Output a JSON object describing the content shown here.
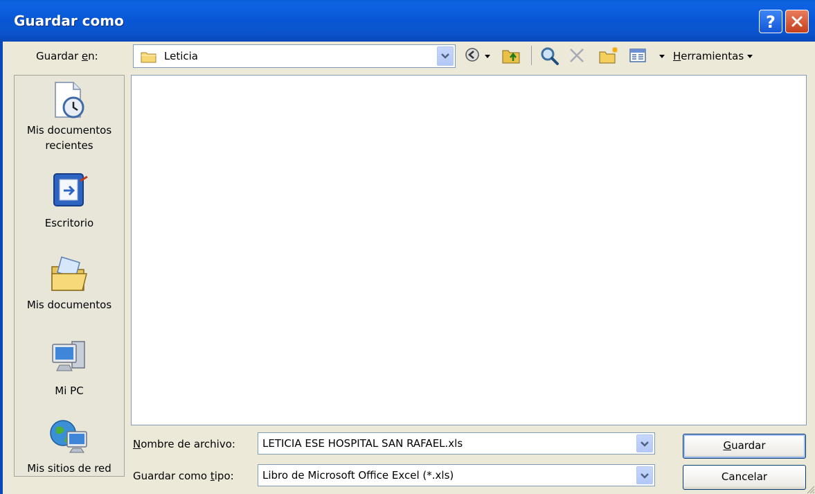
{
  "window": {
    "title": "Guardar como",
    "help_button": "?",
    "close_button": "close"
  },
  "save_in": {
    "label": "Guardar en:",
    "label_parts": [
      "Guardar ",
      "e",
      "n:"
    ],
    "value": "Leticia"
  },
  "toolbar": {
    "items": [
      "back-icon",
      "up-folder-icon",
      "search-web-icon",
      "delete-icon",
      "new-folder-icon",
      "views-icon"
    ],
    "tools_label": "Herramientas",
    "tools_parts": [
      "H",
      "erramientas"
    ]
  },
  "places": [
    {
      "label_line1": "Mis documentos",
      "label_line2": "recientes",
      "icon": "recent-documents-icon"
    },
    {
      "label_line1": "Escritorio",
      "label_line2": "",
      "icon": "desktop-icon"
    },
    {
      "label_line1": "Mis documentos",
      "label_line2": "",
      "icon": "my-documents-icon"
    },
    {
      "label_line1": "Mi PC",
      "label_line2": "",
      "icon": "my-computer-icon"
    },
    {
      "label_line1": "Mis sitios de red",
      "label_line2": "",
      "icon": "network-places-icon"
    }
  ],
  "file_name": {
    "label": "Nombre de archivo:",
    "label_parts": [
      "N",
      "ombre de archivo:"
    ],
    "value": "LETICIA ESE HOSPITAL SAN RAFAEL.xls"
  },
  "file_type": {
    "label": "Guardar como tipo:",
    "label_parts": [
      "Guardar como ",
      "t",
      "ipo:"
    ],
    "value": "Libro de Microsoft Office Excel (*.xls)"
  },
  "buttons": {
    "save": "Guardar",
    "save_parts": [
      "G",
      "uardar"
    ],
    "cancel": "Cancelar"
  },
  "colors": {
    "titlebar": "#0a5fd8",
    "dialog_bg": "#ece9d8",
    "close_button": "#c4411d"
  }
}
